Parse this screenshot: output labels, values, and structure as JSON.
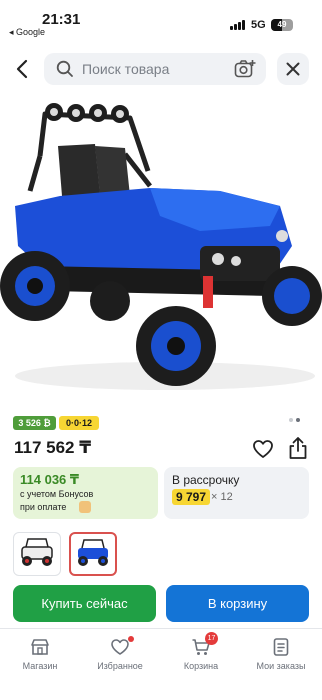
{
  "status_bar": {
    "time": "21:31",
    "back_app": "◂ Google",
    "network": "5G",
    "battery_percent": 49,
    "battery_label": "49"
  },
  "header": {
    "search_placeholder": "Поиск товара"
  },
  "product": {
    "image_icon": "blue-ride-on-utv-toy-car-photo",
    "badge_bonus": "3 526 ₿",
    "badge_installment": "0·0·12",
    "price": "117 562 ₸",
    "carousel_count": 2,
    "carousel_active": 1
  },
  "bonus_card": {
    "price": "114 036 ₸",
    "line1": "с учетом Бонусов",
    "line2": "при оплате"
  },
  "installment_card": {
    "title": "В рассрочку",
    "amount": "9 797",
    "months": "× 12"
  },
  "variants": [
    {
      "icon": "black-white-utv-thumbnail",
      "selected": false
    },
    {
      "icon": "blue-utv-thumbnail",
      "selected": true
    }
  ],
  "actions": {
    "buy_now": "Купить сейчас",
    "add_to_cart": "В корзину"
  },
  "bottom_nav": {
    "items": [
      {
        "label": "Магазин",
        "icon": "shop-icon"
      },
      {
        "label": "Избранное",
        "icon": "heart-icon"
      },
      {
        "label": "Корзина",
        "icon": "cart-icon"
      },
      {
        "label": "Мои заказы",
        "icon": "orders-icon"
      }
    ],
    "cart_count": "17"
  },
  "colors": {
    "buy_green": "#20a045",
    "cart_blue": "#1474d6",
    "bonus_green": "#3a8a26",
    "installment_yellow": "#f7d633",
    "notification_red": "#e43b3b"
  }
}
